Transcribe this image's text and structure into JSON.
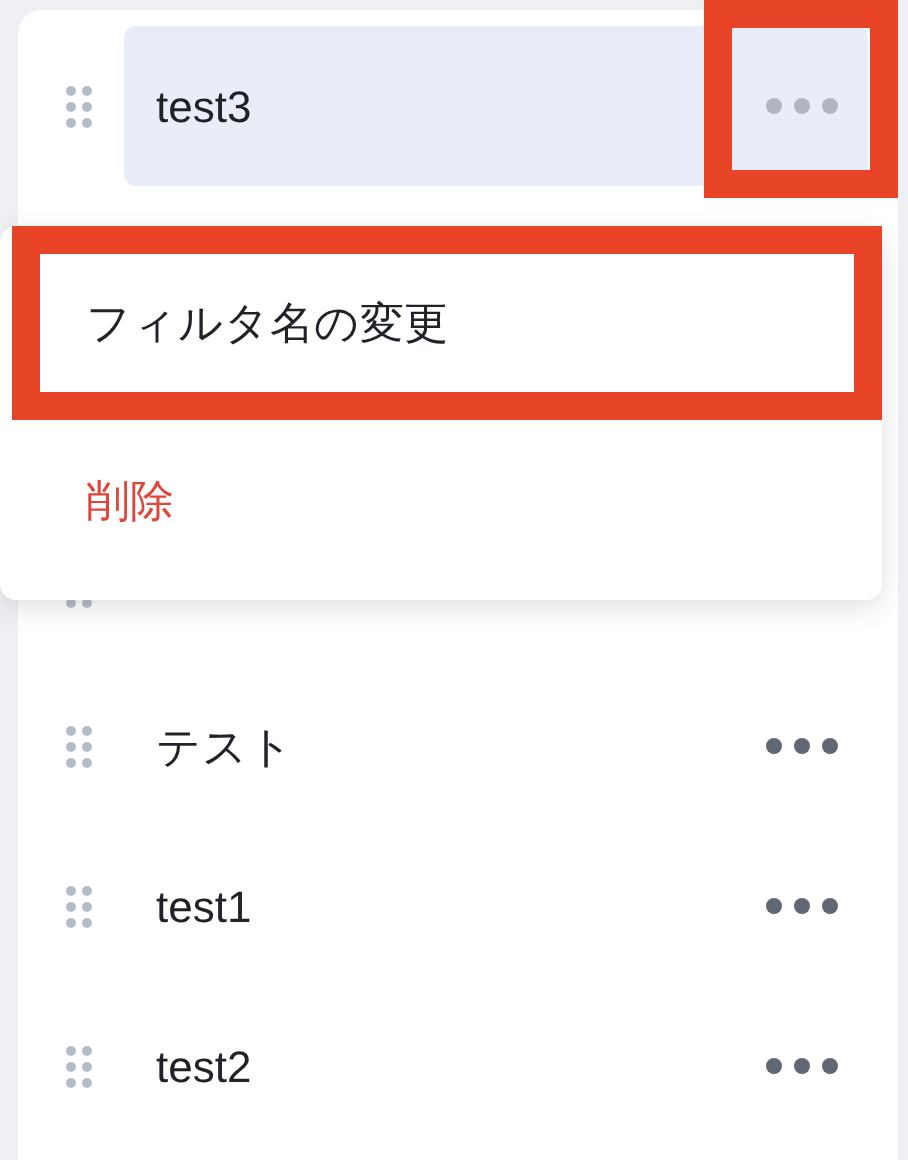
{
  "filters": [
    {
      "name": "test3",
      "selected": true
    },
    {
      "name": "テスト",
      "selected": false
    },
    {
      "name": "test1",
      "selected": false
    },
    {
      "name": "test2",
      "selected": false
    }
  ],
  "more_button_highlighted": true,
  "menu": {
    "items": [
      {
        "label": "フィルタ名の変更",
        "kind": "normal",
        "highlighted": true
      },
      {
        "label": "削除",
        "kind": "danger",
        "highlighted": false
      }
    ]
  }
}
